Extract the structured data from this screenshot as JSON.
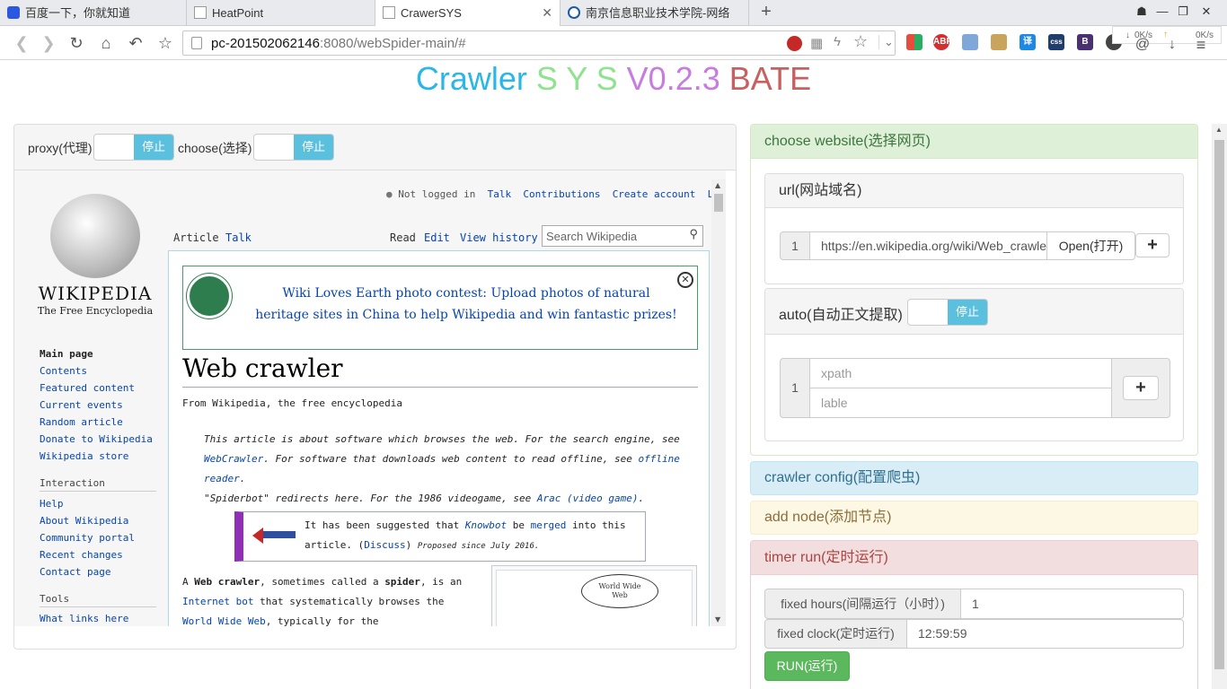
{
  "browser": {
    "tabs": [
      {
        "label": "百度一下，你就知道",
        "active": false
      },
      {
        "label": "HeatPoint",
        "active": false
      },
      {
        "label": "CrawerSYS",
        "active": true
      },
      {
        "label": "南京信息职业技术学院-网络",
        "active": false
      }
    ],
    "address": {
      "host": "pc-201502062146",
      "path": ":8080/webSpider-main/#"
    },
    "net_speed": {
      "down": "0K/s",
      "up": "0K/s"
    },
    "extensions": [
      "ABP",
      "译",
      "css",
      "B"
    ]
  },
  "page": {
    "title_parts": [
      {
        "text": "Crawler ",
        "color": "#29b6e8"
      },
      {
        "text": "S Y S ",
        "color": "#8fe38f"
      },
      {
        "text": "V0.2.3 ",
        "color": "#c77de0"
      },
      {
        "text": "BATE",
        "color": "#c86060"
      }
    ]
  },
  "left_panel": {
    "proxy_label": "proxy(代理)",
    "proxy_toggle": "停止",
    "choose_label": "choose(选择)",
    "choose_toggle": "停止"
  },
  "wiki": {
    "logo_title": "WIKIPEDIA",
    "logo_sub": "The Free Encyclopedia",
    "personal": [
      "Not logged in",
      "Talk",
      "Contributions",
      "Create account",
      "Log in"
    ],
    "tabs_left": [
      "Article",
      "Talk"
    ],
    "tabs_right": [
      "Read",
      "Edit",
      "View history"
    ],
    "search_placeholder": "Search Wikipedia",
    "banner": "Wiki Loves Earth photo contest: Upload photos of natural heritage sites in China to help Wikipedia and win fantastic prizes!",
    "heading": "Web crawler",
    "from": "From Wikipedia, the free encyclopedia",
    "hatnote1_a": "This article is about software which browses the web. For the search engine, see ",
    "hatnote1_link1": "WebCrawler",
    "hatnote1_b": ". For software that downloads web content to read offline, see ",
    "hatnote1_link2": "offline reader",
    "hatnote1_c": ".",
    "hatnote2_a": "\"Spiderbot\" redirects here. For the 1986 videogame, see ",
    "hatnote2_link": "Arac (video game)",
    "hatnote2_b": ".",
    "merge_a": "It has been suggested that ",
    "merge_link1": "Knowbot",
    "merge_b": " be ",
    "merge_link2": "merged",
    "merge_c": " into this article. (",
    "merge_link3": "Discuss",
    "merge_d": ") ",
    "merge_small": "Proposed since July 2016.",
    "body_a": "A ",
    "body_b1": "Web crawler",
    "body_c": ", sometimes called a ",
    "body_b2": "spider",
    "body_d": ", is an ",
    "body_link": "Internet bot",
    "body_e": " that systematically browses the ",
    "body_link2": "World Wide Web",
    "body_f": ", typically for the",
    "figure_label": "World Wide Web",
    "nav_main": [
      "Main page",
      "Contents",
      "Featured content",
      "Current events",
      "Random article",
      "Donate to Wikipedia",
      "Wikipedia store"
    ],
    "interaction_head": "Interaction",
    "nav_interaction": [
      "Help",
      "About Wikipedia",
      "Community portal",
      "Recent changes",
      "Contact page"
    ],
    "tools_head": "Tools",
    "tools_first": "What links here"
  },
  "right": {
    "choose_website": "choose website(选择网页)",
    "url_title": "url(网站域名)",
    "url_index": "1",
    "url_value": "https://en.wikipedia.org/wiki/Web_crawler",
    "open_button": "Open(打开)",
    "plus": "+",
    "auto_label": "auto(自动正文提取)",
    "auto_toggle": "停止",
    "xpath_index": "1",
    "xpath_placeholder": "xpath",
    "lable_placeholder": "lable",
    "crawler_config": "crawler config(配置爬虫)",
    "add_node": "add node(添加节点)",
    "timer_run": "timer run(定时运行)",
    "fixed_hours_label": "fixed hours(间隔运行（小时）)",
    "fixed_hours_value": "1",
    "fixed_clock_label": "fixed clock(定时运行)",
    "fixed_clock_value": "12:59:59",
    "run_button": "RUN(运行)"
  }
}
